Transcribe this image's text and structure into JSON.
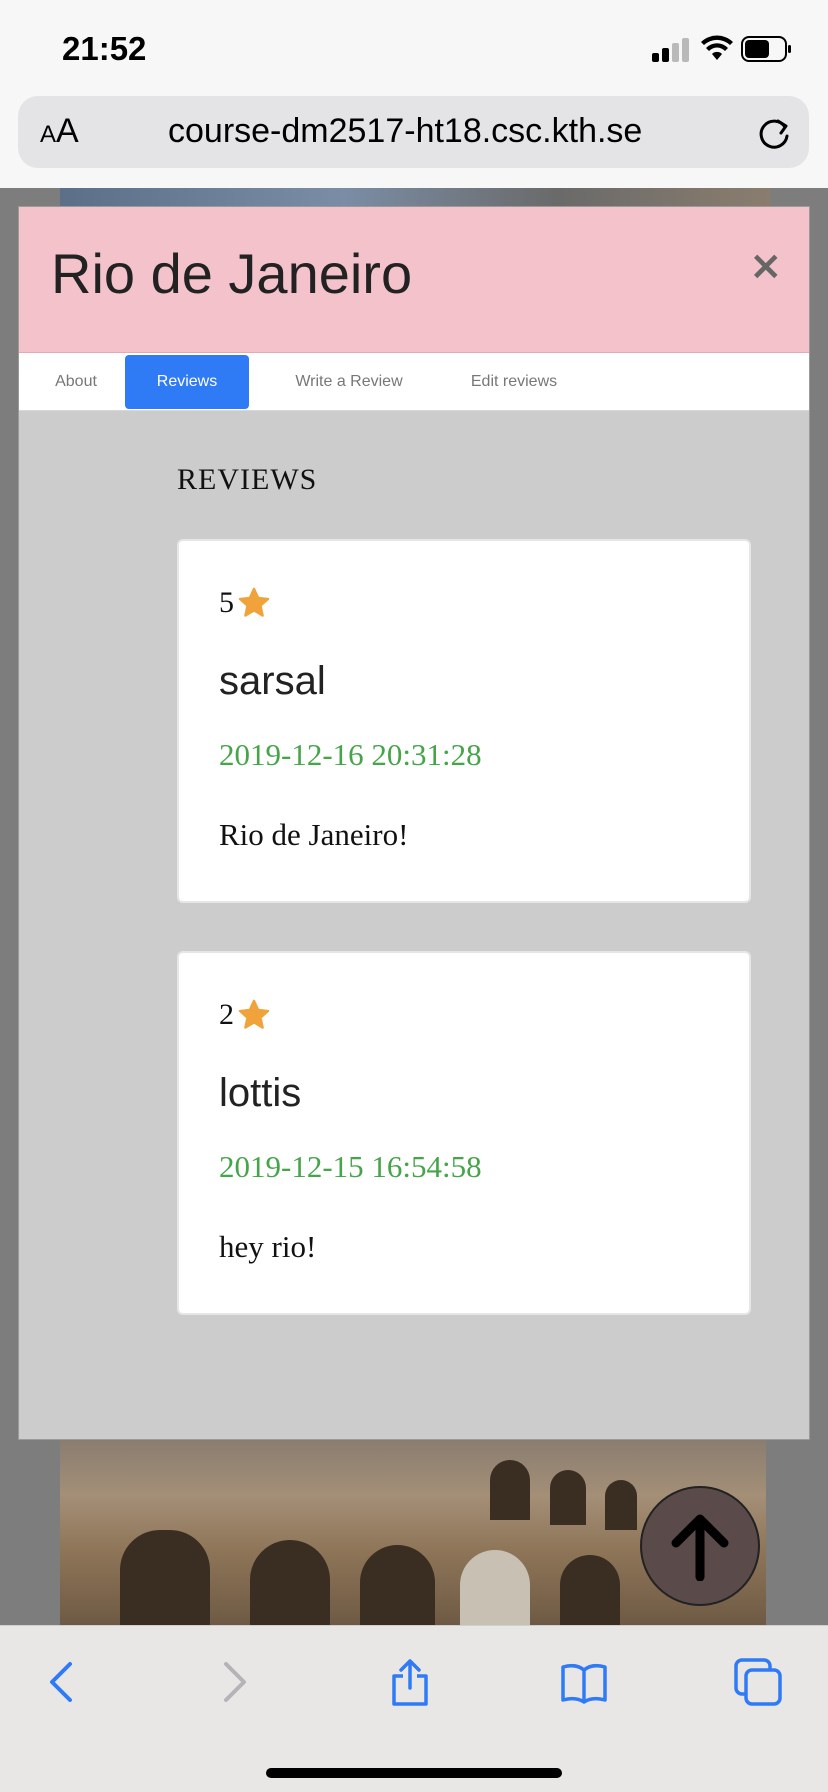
{
  "status_bar": {
    "time": "21:52"
  },
  "browser": {
    "aa_small": "A",
    "aa_large": "A",
    "url": "course-dm2517-ht18.csc.kth.se"
  },
  "modal": {
    "title": "Rio de Janeiro",
    "close_symbol": "×",
    "tabs": [
      {
        "label": "About",
        "active": false
      },
      {
        "label": "Reviews",
        "active": true
      },
      {
        "label": "Write a Review",
        "active": false
      },
      {
        "label": "Edit reviews",
        "active": false
      }
    ],
    "section_heading": "REVIEWS",
    "reviews": [
      {
        "rating": "5",
        "user": "sarsal",
        "date": "2019-12-16 20:31:28",
        "text": "Rio de Janeiro!"
      },
      {
        "rating": "2",
        "user": "lottis",
        "date": "2019-12-15 16:54:58",
        "text": "hey rio!"
      }
    ]
  },
  "colors": {
    "header_bg": "#f4c2cb",
    "active_tab": "#2f7af5",
    "date_green": "#46a54a",
    "star": "#f0a33a",
    "toolbar_blue": "#2f7af5"
  },
  "icons": {
    "star": "star-icon",
    "scroll_top": "arrow-up-icon",
    "back": "chevron-left-icon",
    "forward": "chevron-right-icon",
    "share": "share-icon",
    "bookmarks": "book-icon",
    "tabs": "tabs-icon",
    "reload": "reload-icon"
  }
}
